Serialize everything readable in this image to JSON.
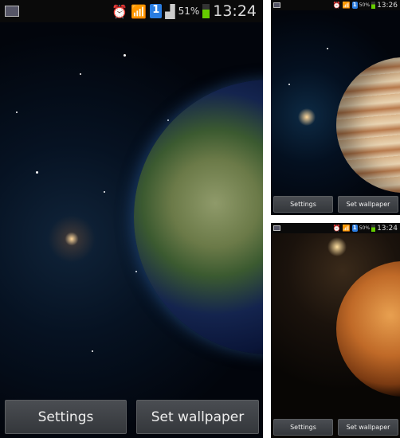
{
  "screens": [
    {
      "name": "earth",
      "status": {
        "battery": "51%",
        "time": "13:24",
        "notification_count": "1"
      },
      "buttons": {
        "settings": "Settings",
        "set_wallpaper": "Set wallpaper"
      }
    },
    {
      "name": "jupiter",
      "status": {
        "battery": "50%",
        "time": "13:26",
        "notification_count": "1"
      },
      "buttons": {
        "settings": "Settings",
        "set_wallpaper": "Set wallpaper"
      }
    },
    {
      "name": "venus",
      "status": {
        "battery": "50%",
        "time": "13:24",
        "notification_count": "1"
      },
      "buttons": {
        "settings": "Settings",
        "set_wallpaper": "Set wallpaper"
      }
    }
  ],
  "colors": {
    "battery": "#66cc00",
    "notification": "#2a7de1"
  }
}
